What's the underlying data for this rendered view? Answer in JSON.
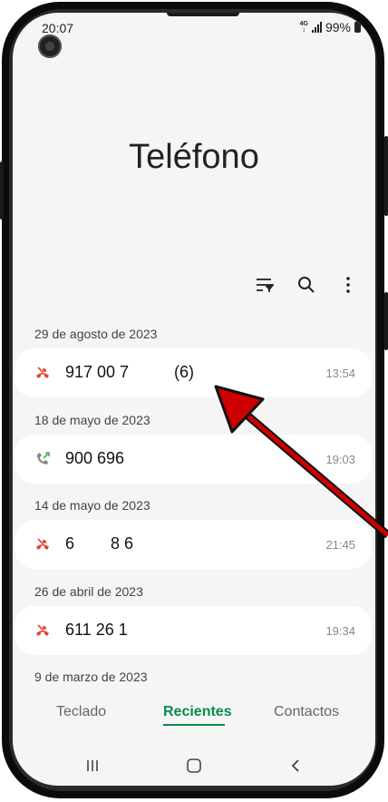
{
  "status": {
    "time": "20:07",
    "network": "4G",
    "battery": "99%",
    "battery_level": 0.99
  },
  "app": {
    "title": "Teléfono"
  },
  "toolbar": {
    "icons": [
      "filter-icon",
      "search-icon",
      "more-vert-icon"
    ]
  },
  "calls": [
    {
      "date": "29 de agosto de 2023",
      "number": "917 00 7",
      "count": "(6)",
      "time": "13:54",
      "type": "missed",
      "icon": "missed-call-icon"
    },
    {
      "date": "18 de mayo de 2023",
      "number": "900 696",
      "count": "",
      "time": "19:03",
      "type": "outgoing",
      "icon": "outgoing-call-icon"
    },
    {
      "date": "14 de mayo de 2023",
      "number": "6        8 6",
      "count": "",
      "time": "21:45",
      "type": "missed",
      "icon": "missed-call-icon"
    },
    {
      "date": "26 de abril de 2023",
      "number": "611 26 1",
      "count": "",
      "time": "19:34",
      "type": "missed",
      "icon": "missed-call-icon"
    }
  ],
  "next_section": {
    "date": "9 de marzo de 2023"
  },
  "tabs": {
    "keypad": "Teclado",
    "recents": "Recientes",
    "contacts": "Contactos",
    "active": "recents"
  },
  "colors": {
    "missed": "#e0442c",
    "outgoing": "#4caf50",
    "accent": "#0a8a4a",
    "arrow": "#cc0000"
  }
}
